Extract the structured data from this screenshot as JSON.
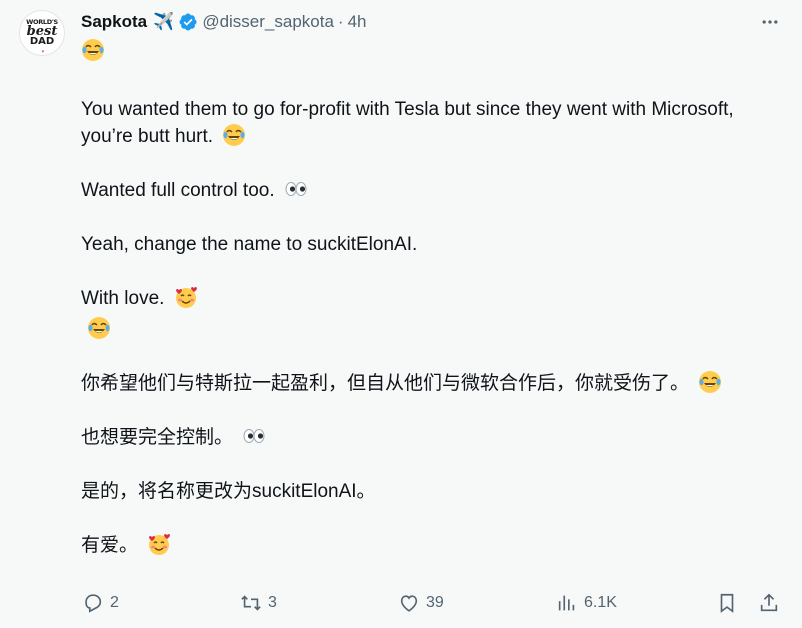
{
  "author": {
    "name": "Sapkota",
    "name_emoji": "✈️",
    "handle": "@disser_sapkota",
    "separator": "·",
    "time": "4h",
    "avatar_text": [
      "WORLD'S",
      "best",
      "DAD"
    ]
  },
  "tweet": {
    "line1_emoji": "tears-of-joy",
    "p1": "You wanted them to go for-profit with Tesla but since they went with Microsoft, you’re butt hurt.",
    "p2": "Wanted full control too.",
    "p3": "Yeah, change the name to suckitElonAI.",
    "p4": "With love.",
    "p5_emoji": "tears-of-joy",
    "zh1": "你希望他们与特斯拉一起盈利，但自从他们与微软合作后，你就受伤了。",
    "zh2": "也想要完全控制。",
    "zh3": "是的，将名称更改为suckitElonAI。",
    "zh4": "有爱。"
  },
  "actions": {
    "replies": "2",
    "reposts": "3",
    "likes": "39",
    "views": "6.1K"
  },
  "colors": {
    "text": "#0f1419",
    "secondary": "#536471",
    "verified": "#1d9bf0",
    "background": "#f7f9f9"
  }
}
